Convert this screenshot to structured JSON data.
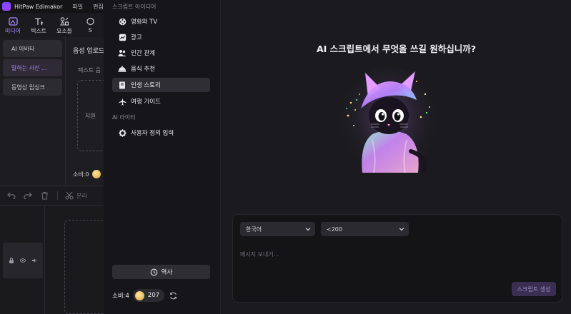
{
  "app": {
    "name": "HitPaw Edimakor",
    "menu": [
      "파일",
      "편집"
    ]
  },
  "toolbar": {
    "tools": [
      {
        "label": "미디어",
        "icon": "media-icon",
        "active": true
      },
      {
        "label": "텍스트",
        "icon": "text-icon",
        "active": false
      },
      {
        "label": "요소들",
        "icon": "elements-icon",
        "active": false
      },
      {
        "label": "S",
        "icon": "sticker-icon",
        "active": false
      }
    ]
  },
  "leftnav": {
    "items": [
      "AI 아바타",
      "말하는 사진 ...",
      "동영상 립싱크"
    ],
    "active_index": 1
  },
  "midpanel": {
    "title": "음성 업로드",
    "subtitle": "텍스트 음",
    "box_text": "지원",
    "cost_label": "소비:0"
  },
  "editbar": {
    "split_label": "분리"
  },
  "dialog": {
    "sections": [
      {
        "label": "스크립트 아이디어",
        "items": [
          {
            "label": "영화와 TV",
            "icon": "film-reel-icon"
          },
          {
            "label": "광고",
            "icon": "ad-chart-icon"
          },
          {
            "label": "인간 관계",
            "icon": "people-icon"
          },
          {
            "label": "음식 추천",
            "icon": "food-dish-icon"
          },
          {
            "label": "인생 스토리",
            "icon": "book-icon",
            "active": true
          },
          {
            "label": "여행 가이드",
            "icon": "airplane-icon"
          }
        ]
      },
      {
        "label": "AI 라이터",
        "items": [
          {
            "label": "사용자 정의 입력",
            "icon": "gear-icon"
          }
        ]
      }
    ],
    "history_label": "역사",
    "cost_label": "소비:4",
    "credits": "207",
    "question": "AI 스크립트에서 무엇을 쓰길 원하십니까?",
    "language_select": "한국어",
    "length_select": "<200",
    "message_placeholder": "메시지 보내기...",
    "generate_label": "스크립트 생성"
  },
  "colors": {
    "accent": "#a98bff",
    "generate_bg": "#3a2f52"
  }
}
